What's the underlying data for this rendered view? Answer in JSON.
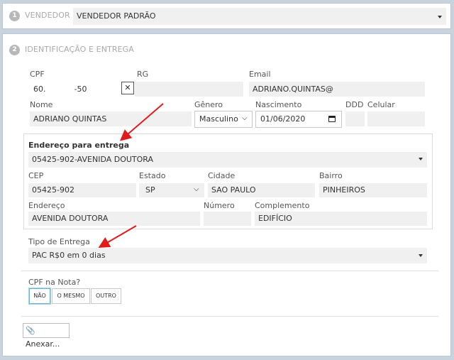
{
  "step1": {
    "number": "1",
    "title": "VENDEDOR",
    "value": "VENDEDOR PADRÃO"
  },
  "step2": {
    "number": "2",
    "title": "IDENTIFICAÇÃO E ENTREGA"
  },
  "labels": {
    "cpf": "CPF",
    "rg": "RG",
    "email": "Email",
    "nome": "Nome",
    "genero": "Gênero",
    "nascimento": "Nascimento",
    "ddd": "DDD",
    "celular": "Celular",
    "endereco_entrega": "Endereço para entrega",
    "cep": "CEP",
    "estado": "Estado",
    "cidade": "Cidade",
    "bairro": "Bairro",
    "endereco": "Endereço",
    "numero": "Número",
    "complemento": "Complemento",
    "tipo_entrega": "Tipo de Entrega",
    "cpf_nota": "CPF na Nota?"
  },
  "values": {
    "cpf_start": "60.",
    "cpf_end": "-50",
    "clear_symbol": "✕",
    "email": "ADRIANO.QUINTAS@",
    "nome": "ADRIANO QUINTAS",
    "genero": "Masculino",
    "nascimento": "01/06/2020",
    "endereco_entrega": "05425-902-AVENIDA DOUTORA",
    "cep": "05425-902",
    "estado": "SP",
    "cidade": "SAO PAULO",
    "bairro": "PINHEIROS",
    "endereco": "AVENIDA DOUTORA",
    "numero": "",
    "complemento": "EDIFÍCIO",
    "tipo_entrega": "PAC R$0 em 0 dias"
  },
  "cpf_nota_options": [
    "NÃO",
    "O MESMO",
    "OUTRO"
  ],
  "attach_label": "Anexar...",
  "colors": {
    "annotation_arrow": "#e11b1b",
    "selected_option_border": "#6cb2d4",
    "background": "#c9d3de"
  }
}
